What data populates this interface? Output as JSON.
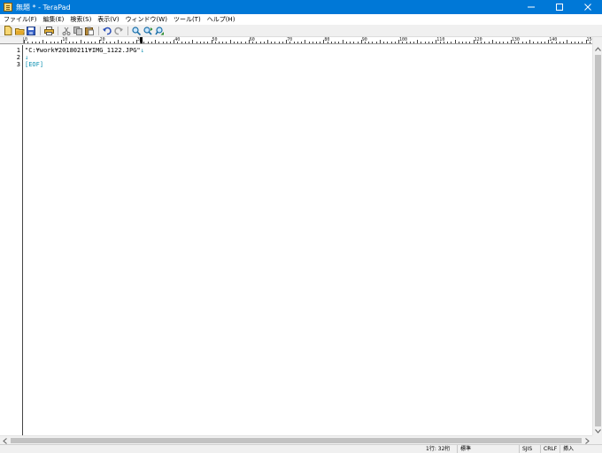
{
  "window": {
    "title": "無題 * - TeraPad",
    "minimize_glyph": "—",
    "maximize_glyph": "☐",
    "close_glyph": "✕"
  },
  "menu": [
    {
      "label": "ファイル(F)"
    },
    {
      "label": "編集(E)"
    },
    {
      "label": "検索(S)"
    },
    {
      "label": "表示(V)"
    },
    {
      "label": "ウィンドウ(W)"
    },
    {
      "label": "ツール(T)"
    },
    {
      "label": "ヘルプ(H)"
    }
  ],
  "toolbar": {
    "buttons": [
      {
        "icon": "new-file-icon"
      },
      {
        "icon": "open-folder-icon"
      },
      {
        "icon": "save-icon"
      },
      {
        "icon": "print-icon"
      },
      {
        "icon": "cut-icon"
      },
      {
        "icon": "copy-icon"
      },
      {
        "icon": "paste-icon"
      },
      {
        "icon": "undo-icon"
      },
      {
        "icon": "redo-icon"
      },
      {
        "icon": "find-icon"
      },
      {
        "icon": "find-next-icon"
      },
      {
        "icon": "find-prev-icon"
      }
    ]
  },
  "ruler": {
    "labels": [
      "0",
      "10",
      "20",
      "30",
      "40",
      "50",
      "60",
      "70",
      "80",
      "90",
      "100",
      "110",
      "120",
      "130",
      "140",
      "150"
    ]
  },
  "editor": {
    "line_numbers": [
      "1",
      "2",
      "3"
    ],
    "lines": [
      {
        "text": "\"C:¥work¥20180211¥IMG_1122.JPG\"",
        "mark": "↓"
      },
      {
        "text": "",
        "mark": "↓"
      },
      {
        "text": "",
        "mark": "[EOF]"
      }
    ]
  },
  "status": {
    "position": "1行: 32桁",
    "mode": "標準",
    "encoding": "SJIS",
    "line_ending": "CRLF",
    "insert_mode": "挿入"
  },
  "colors": {
    "titlebar": "#0078d7",
    "newline_mark": "#0a8fb0"
  }
}
